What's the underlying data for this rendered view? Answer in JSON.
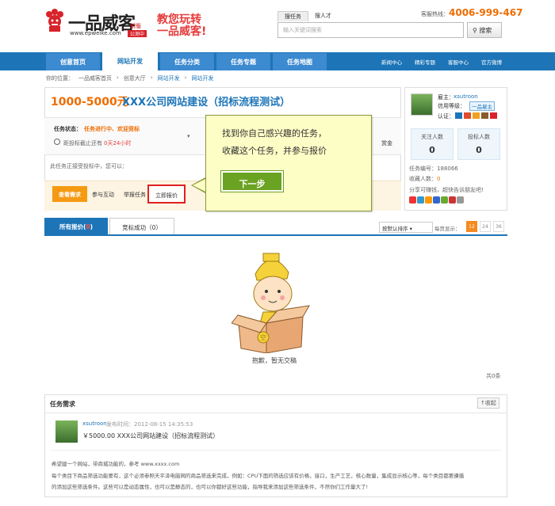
{
  "header": {
    "logo_text": "一品威客",
    "logo_url": "www.epweike.com",
    "logo_badge": "新版",
    "logo_badge2": "公测中",
    "slogan_1": "教您玩转",
    "slogan_2": "一品威客!",
    "search_tabs": [
      "搜任务",
      "搜人才"
    ],
    "search_placeholder": "输入关键词搜索",
    "search_button": "搜索",
    "hotline_label": "客服热线：",
    "hotline": "4006-999-467"
  },
  "nav": {
    "items": [
      "创意首页",
      "网站开发",
      "任务分类",
      "任务专题",
      "任务地图"
    ],
    "links": [
      "新闻中心",
      "精彩专题",
      "客服中心",
      "官方微博"
    ]
  },
  "breadcrumb": [
    "你的位置：",
    "一品威客首页",
    "创意大厅",
    "网站开发",
    "网站开发"
  ],
  "task": {
    "price": "1000-5000元",
    "title": "XXX公司网站建设（招标流程测试）",
    "status_label": "任务状态：",
    "status_value": "任务进行中、欢迎竞标",
    "remain_label": "距投标截止还有",
    "remain_value": "0天24小时",
    "money_label": "赏金",
    "in_progress": "此任务正接受投标中，您可以：",
    "actions": [
      "查看需求",
      "参与互动",
      "举报任务",
      "立即报价"
    ]
  },
  "sidebar": {
    "employer_label": "雇主：",
    "employer": "xsutroon",
    "credit_label": "信用等级：",
    "credit_badge": "一品雇主",
    "cert_label": "认证：",
    "stats": [
      {
        "label": "关注人数",
        "value": "0"
      },
      {
        "label": "投标人数",
        "value": "0"
      }
    ],
    "task_no": "任务编号：188066",
    "fav_label": "收藏人数：",
    "fav_value": "0",
    "share_text": "分享可赚钱，超快告诉朋友吧!"
  },
  "tooltip": {
    "line1": "找到你自己感兴趣的任务，",
    "line2": "收藏这个任务，并参与报价",
    "button": "下一步"
  },
  "bids": {
    "tab_all": "所有报价(",
    "tab_all_count": "0",
    "tab_all_close": ")",
    "tab_won": "竞标成功（0）",
    "sort": "按默认排序",
    "per_page_label": "每页显示：",
    "per_page": [
      "12",
      "24",
      "36"
    ],
    "empty": "抱歉，暂无交稿",
    "total": "共0条"
  },
  "requirement": {
    "title": "任务需求",
    "collapse": "↑收起",
    "user": "xsutroon",
    "time": "发布时间：2012-08-15 14:35:53",
    "name": "￥5000.00 XXX公司网站建设（招标流程测试）",
    "body": [
      "希望建一个网站，带商城功能的，参考 www.xxxx.com",
      "每个类目下商品筛选功能要有，这个必须参照天平泽电脑网的商品筛选来完成，例如：CPU下面的筛选应该有价格，接口，生产工艺，核心数量，集成显示核心等，每个类目都要遵循",
      "的添加这些筛选条件。这些可以是动态属性，也可以是静态的，也可以你都好这些功能，指导我来添加这些筛选条件，不然你们工作量大了!"
    ]
  },
  "colors": {
    "brand_blue": "#1d75b8",
    "accent_orange": "#ef6c00",
    "tip_green": "#6aa222"
  }
}
